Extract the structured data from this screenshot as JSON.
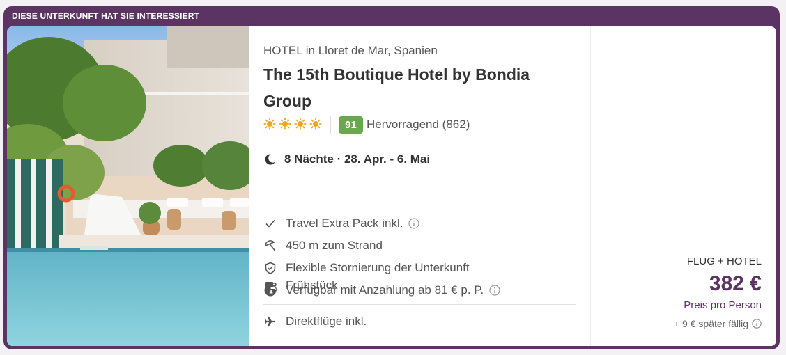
{
  "banner": {
    "text": "DIESE UNTERKUNFT HAT SIE INTERESSIERT"
  },
  "hotel": {
    "type_location": "HOTEL in Lloret de Mar, Spanien",
    "name": "The 15th Boutique Hotel by Bondia Group",
    "stars": 4,
    "score": "91",
    "rating_text": "Hervorragend (862)"
  },
  "stay": {
    "text": "8 Nächte · 28. Apr. - 6. Mai",
    "icon": "moon-icon"
  },
  "features": [
    {
      "label": "Travel Extra Pack inkl.",
      "icon": "check-icon",
      "info": true
    },
    {
      "label": "450 m zum Strand",
      "icon": "beach-umbrella-icon",
      "info": false
    },
    {
      "label": "Flexible Stornierung der Unterkunft",
      "icon": "shield-check-icon",
      "info": false
    },
    {
      "label": "Verfügbar mit Anzahlung ab 81 € p. P.",
      "icon": "deposit-coin-icon",
      "info": true
    },
    {
      "label": "Frühstück",
      "icon": "coffee-cup-icon",
      "info": false
    }
  ],
  "flight": {
    "label": "Direktflüge inkl.",
    "icon": "airplane-icon"
  },
  "price": {
    "package": "FLUG + HOTEL",
    "amount": "382 €",
    "per_person": "Preis pro Person",
    "later": "+ 9 € später fällig"
  },
  "colors": {
    "brand": "#5c3463",
    "score": "#6aa84f",
    "star": "#f2a51a"
  }
}
